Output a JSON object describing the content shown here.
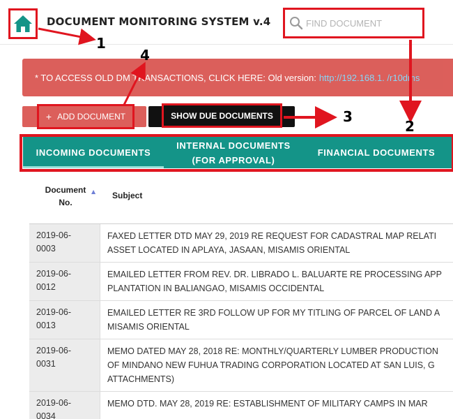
{
  "header": {
    "home_icon": "home-icon",
    "title": "DOCUMENT MONITORING SYSTEM v.4",
    "search": {
      "placeholder": "FIND DOCUMENT",
      "value": "",
      "icon": "search-icon"
    }
  },
  "alert": {
    "text": "* TO ACCESS OLD DM  TRANSACTIONS, CLICK HERE: Old version:",
    "link": "http://192.168.1.  /r10dms"
  },
  "actions": {
    "add_label": "ADD DOCUMENT",
    "add_icon": "+",
    "due_label": "SHOW DUE DOCUMENTS"
  },
  "tabs": [
    {
      "label": "INCOMING DOCUMENTS"
    },
    {
      "label_line1": "INTERNAL DOCUMENTS",
      "label_line2": "(FOR APPROVAL)"
    },
    {
      "label": "FINANCIAL DOCUMENTS"
    }
  ],
  "table": {
    "headers": {
      "doc_no_line1": "Document",
      "doc_no_line2": "No.",
      "subject": "Subject"
    },
    "rows": [
      {
        "no_year": "2019-06-",
        "no_seq": "0003",
        "subject_lines": [
          "FAXED LETTER DTD MAY 29, 2019 RE REQUEST FOR CADASTRAL MAP RELATI",
          "ASSET LOCATED IN APLAYA, JASAAN, MISAMIS ORIENTAL"
        ]
      },
      {
        "no_year": "2019-06-",
        "no_seq": "0012",
        "subject_lines": [
          "EMAILED LETTER FROM REV. DR. LIBRADO L. BALUARTE RE PROCESSING APP",
          "PLANTATION IN BALIANGAO, MISAMIS OCCIDENTAL"
        ]
      },
      {
        "no_year": "2019-06-",
        "no_seq": "0013",
        "subject_lines": [
          "EMAILED LETTER RE 3RD FOLLOW UP FOR MY TITLING OF PARCEL OF LAND A",
          "MISAMIS ORIENTAL"
        ]
      },
      {
        "no_year": "2019-06-",
        "no_seq": "0031",
        "subject_lines": [
          "MEMO DATED MAY 28, 2018 RE: MONTHLY/QUARTERLY LUMBER PRODUCTION",
          "OF MINDANO NEW FUHUA TRADING CORPORATION LOCATED AT SAN LUIS, G",
          "ATTACHMENTS)"
        ]
      },
      {
        "no_year": "2019-06-",
        "no_seq": "0034",
        "subject_lines": [
          "MEMO DTD. MAY 28, 2019 RE: ESTABLISHMENT OF MILITARY CAMPS IN MAR"
        ]
      }
    ]
  },
  "annotations": {
    "color": "#e0151f",
    "labels": [
      "1",
      "2",
      "3",
      "4"
    ]
  },
  "colors": {
    "teal": "#149488",
    "alert_red": "#d9534f",
    "annotation_red": "#e0151f"
  }
}
